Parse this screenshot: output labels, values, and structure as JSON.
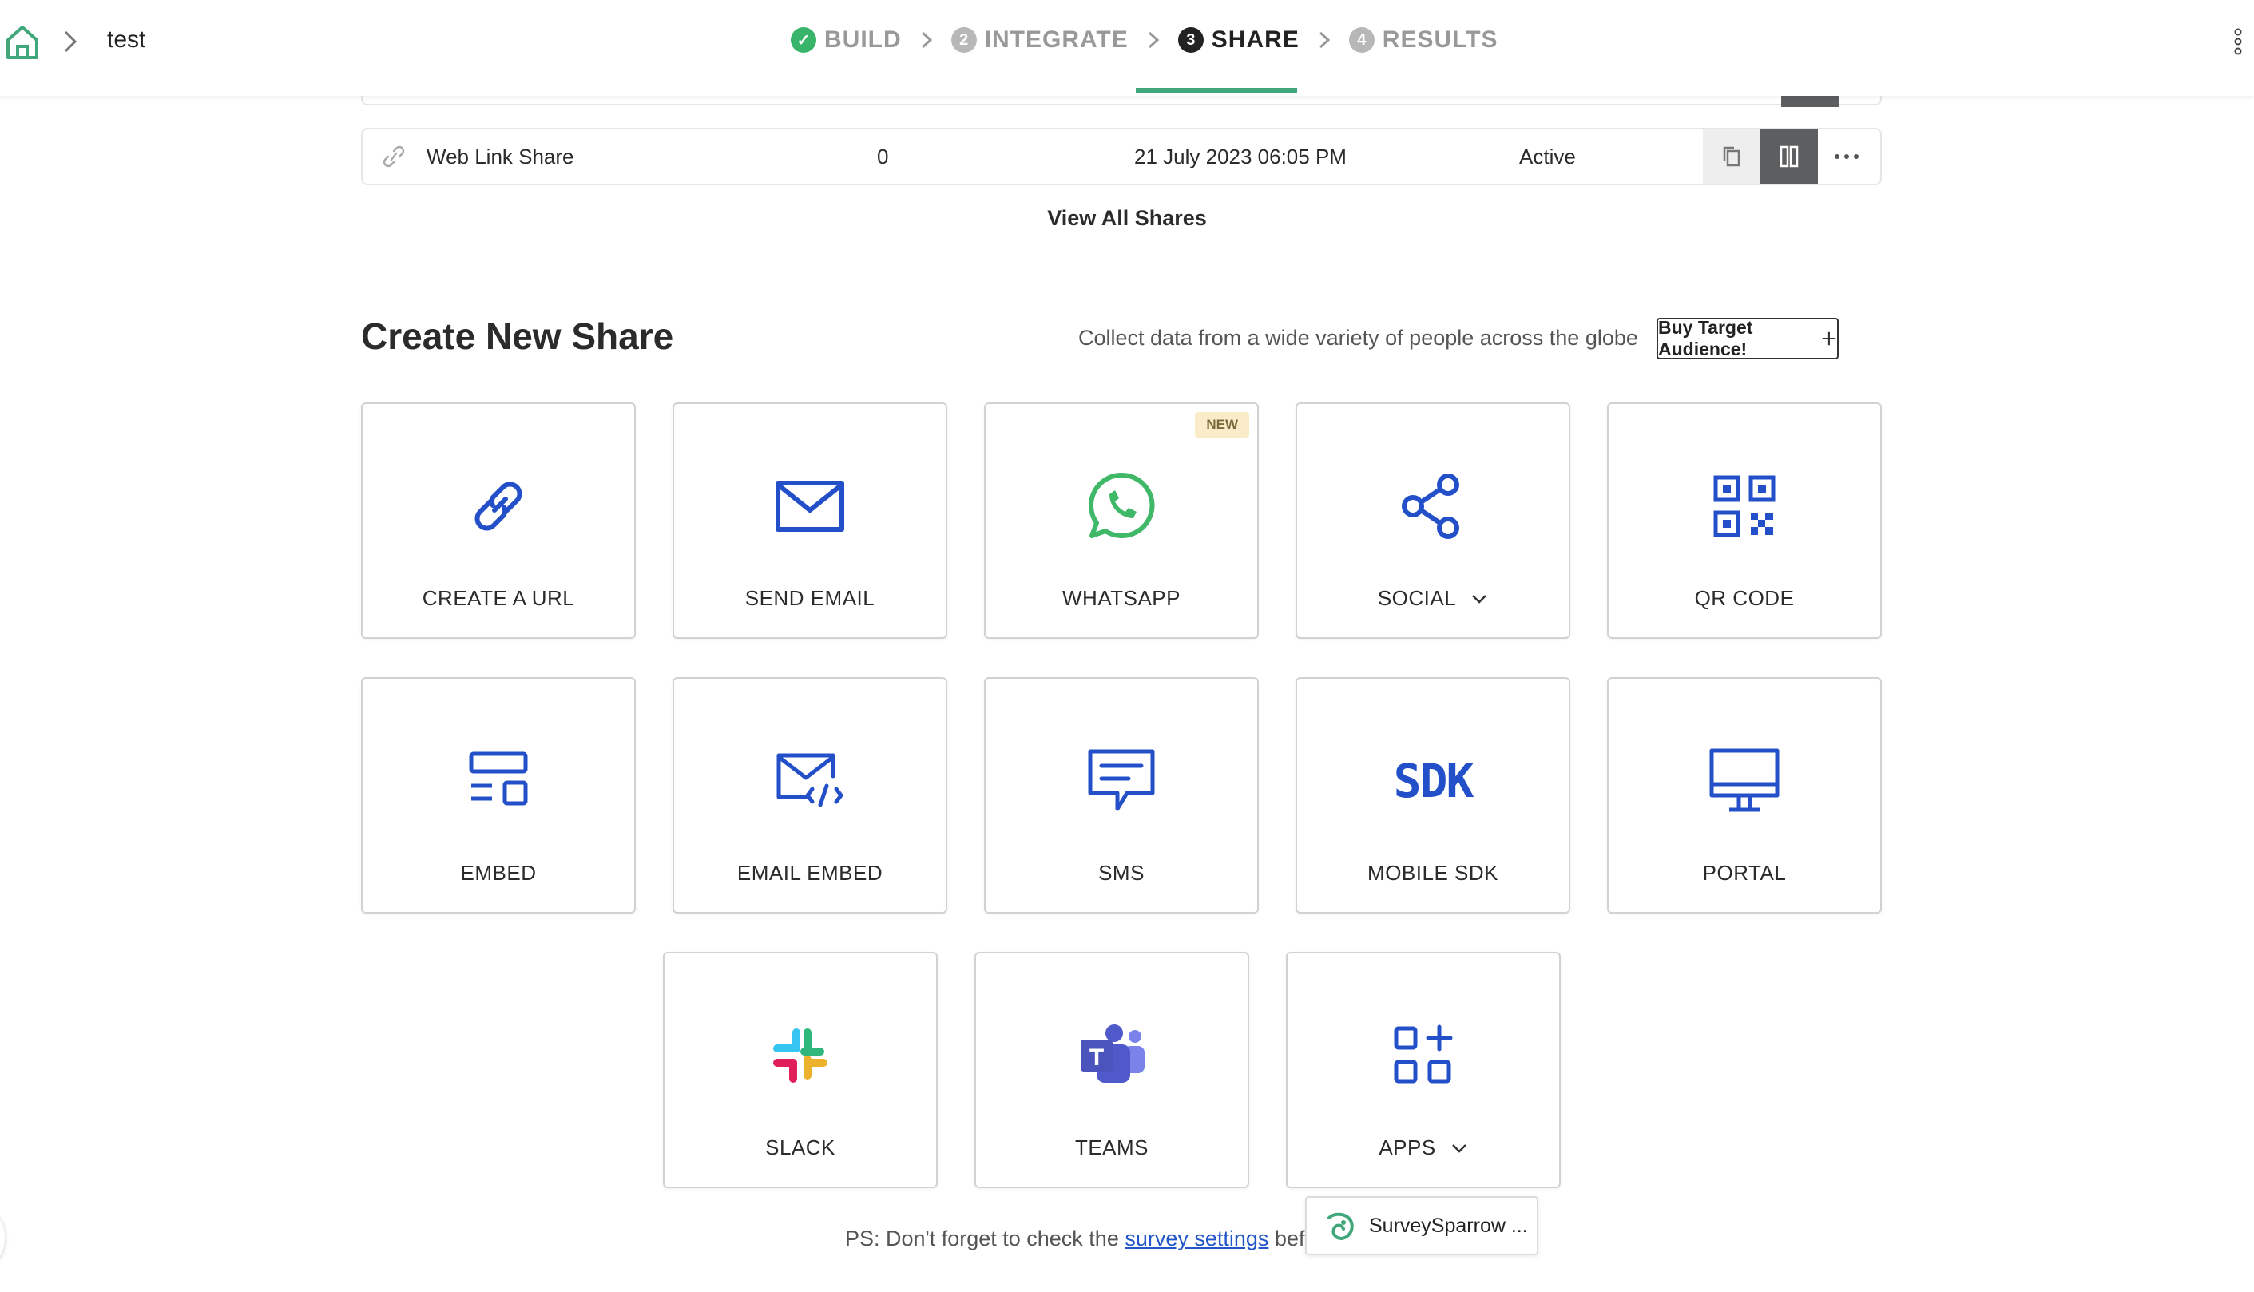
{
  "header": {
    "breadcrumb": "test",
    "steps": [
      {
        "num": "✓",
        "label": "BUILD",
        "state": "done"
      },
      {
        "num": "2",
        "label": "INTEGRATE",
        "state": "pending"
      },
      {
        "num": "3",
        "label": "SHARE",
        "state": "active"
      },
      {
        "num": "4",
        "label": "RESULTS",
        "state": "pending"
      }
    ]
  },
  "shares": {
    "row": {
      "name": "Web Link Share",
      "responses": "0",
      "date": "21 July 2023 06:05 PM",
      "status": "Active"
    },
    "view_all": "View All Shares"
  },
  "create": {
    "title": "Create New Share",
    "subtitle": "Collect data from a wide variety of people across the globe",
    "buy_button": "Buy Target Audience!",
    "tiles": [
      {
        "label": "CREATE A URL",
        "icon": "link-icon"
      },
      {
        "label": "SEND EMAIL",
        "icon": "envelope-icon"
      },
      {
        "label": "WHATSAPP",
        "icon": "whatsapp-icon",
        "badge": "NEW"
      },
      {
        "label": "SOCIAL",
        "icon": "share-icon"
      },
      {
        "label": "QR CODE",
        "icon": "qr-code-icon"
      },
      {
        "label": "EMBED",
        "icon": "embed-icon"
      },
      {
        "label": "EMAIL EMBED",
        "icon": "email-embed-icon"
      },
      {
        "label": "SMS",
        "icon": "sms-icon"
      },
      {
        "label": "MOBILE SDK",
        "icon": "sdk-icon",
        "icon_text": "SDK"
      },
      {
        "label": "PORTAL",
        "icon": "monitor-icon"
      },
      {
        "label": "SLACK",
        "icon": "slack-icon"
      },
      {
        "label": "TEAMS",
        "icon": "teams-icon",
        "icon_text": "T"
      },
      {
        "label": "APPS",
        "icon": "apps-icon"
      }
    ]
  },
  "footer": {
    "ps_prefix": "PS: Don't forget to check the ",
    "ps_link": "survey settings",
    "ps_suffix": " befor",
    "popup": "SurveySparrow ..."
  },
  "colors": {
    "accent_blue": "#2350c8",
    "green": "#3fa77a",
    "whatsapp": "#3fb868",
    "dark_button": "#5c5e60"
  }
}
